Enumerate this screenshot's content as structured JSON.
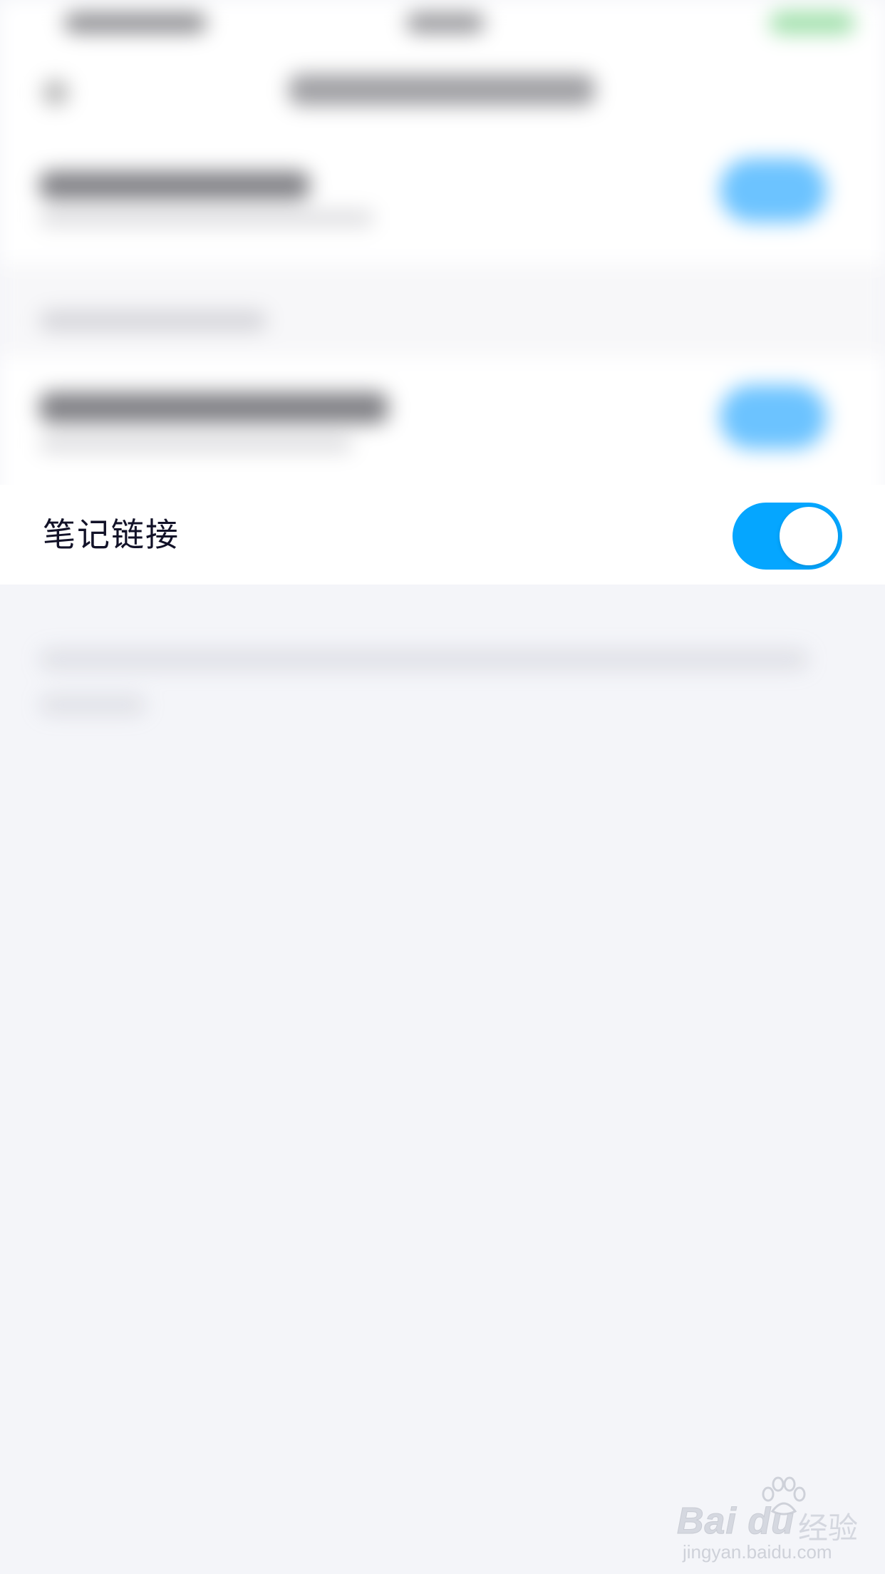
{
  "note_link_row": {
    "label": "笔记链接",
    "toggle_on": true,
    "toggle_color": "#05a6ff"
  },
  "watermark": {
    "brand": "Bai du",
    "jingyan": "经验",
    "url": "jingyan.baidu.com"
  }
}
